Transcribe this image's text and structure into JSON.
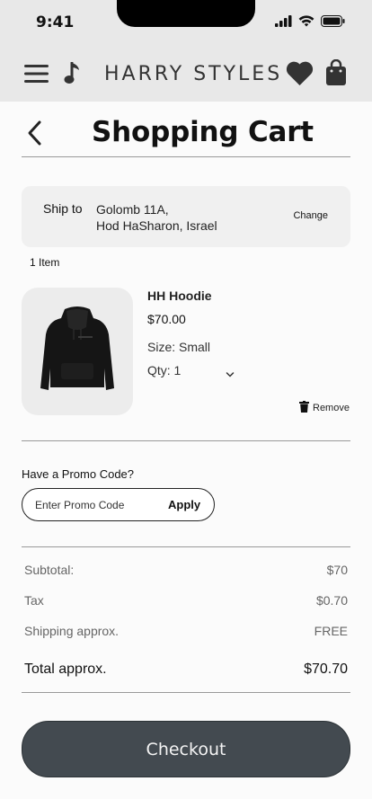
{
  "status_bar": {
    "time": "9:41"
  },
  "header": {
    "brand": "HARRY STYLES"
  },
  "page": {
    "title": "Shopping Cart"
  },
  "shipping": {
    "label": "Ship to",
    "address_line1": "Golomb 11A,",
    "address_line2": "Hod HaSharon, Israel",
    "change_label": "Change"
  },
  "cart": {
    "item_count": "1 Item",
    "items": [
      {
        "name": "HH Hoodie",
        "price": "$70.00",
        "size": "Size: Small",
        "qty": "Qty: 1",
        "remove_label": "Remove"
      }
    ]
  },
  "promo": {
    "heading": "Have a Promo Code?",
    "placeholder": "Enter Promo Code",
    "apply_label": "Apply"
  },
  "summary": {
    "subtotal_label": "Subtotal:",
    "subtotal_value": "$70",
    "tax_label": "Tax",
    "tax_value": "$0.70",
    "shipping_label": "Shipping approx.",
    "shipping_value": "FREE",
    "total_label": "Total approx.",
    "total_value": "$70.70"
  },
  "checkout": {
    "label": "Checkout"
  },
  "colors": {
    "header_bg": "#e8e8e8",
    "checkout_bg": "#434a50",
    "card_bg": "#f0f0f0"
  }
}
